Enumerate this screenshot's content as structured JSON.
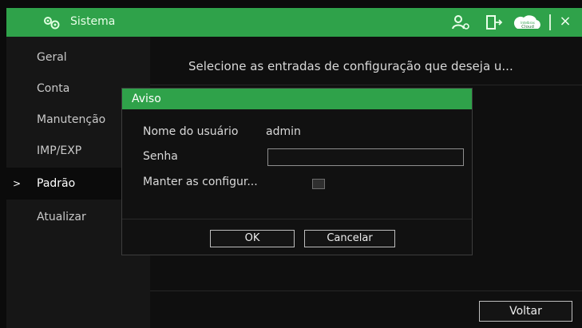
{
  "window": {
    "title": "Sistema",
    "close_glyph": "×",
    "accent_color": "#2fa24a"
  },
  "toolbar": {
    "icons": [
      "settings-icon",
      "user-settings-icon",
      "logout-icon",
      "cloud-icon"
    ],
    "cloud_badge_top": "Intelbras",
    "cloud_badge_bottom": "Cloud"
  },
  "sidebar": {
    "items": [
      {
        "label": "Geral"
      },
      {
        "label": "Conta"
      },
      {
        "label": "Manutenção"
      },
      {
        "label": "IMP/EXP"
      },
      {
        "label": "Padrão"
      },
      {
        "label": "Atualizar"
      }
    ],
    "active_index": 4,
    "active_marker": ">"
  },
  "main": {
    "headline": "Selecione as entradas de configuração que deseja u...",
    "back_label": "Voltar"
  },
  "dialog": {
    "title": "Aviso",
    "username_label": "Nome do usuário",
    "username_value": "admin",
    "password_label": "Senha",
    "password_value": "",
    "keep_label": "Manter as configur...",
    "keep_checked": false,
    "ok_label": "OK",
    "cancel_label": "Cancelar"
  }
}
